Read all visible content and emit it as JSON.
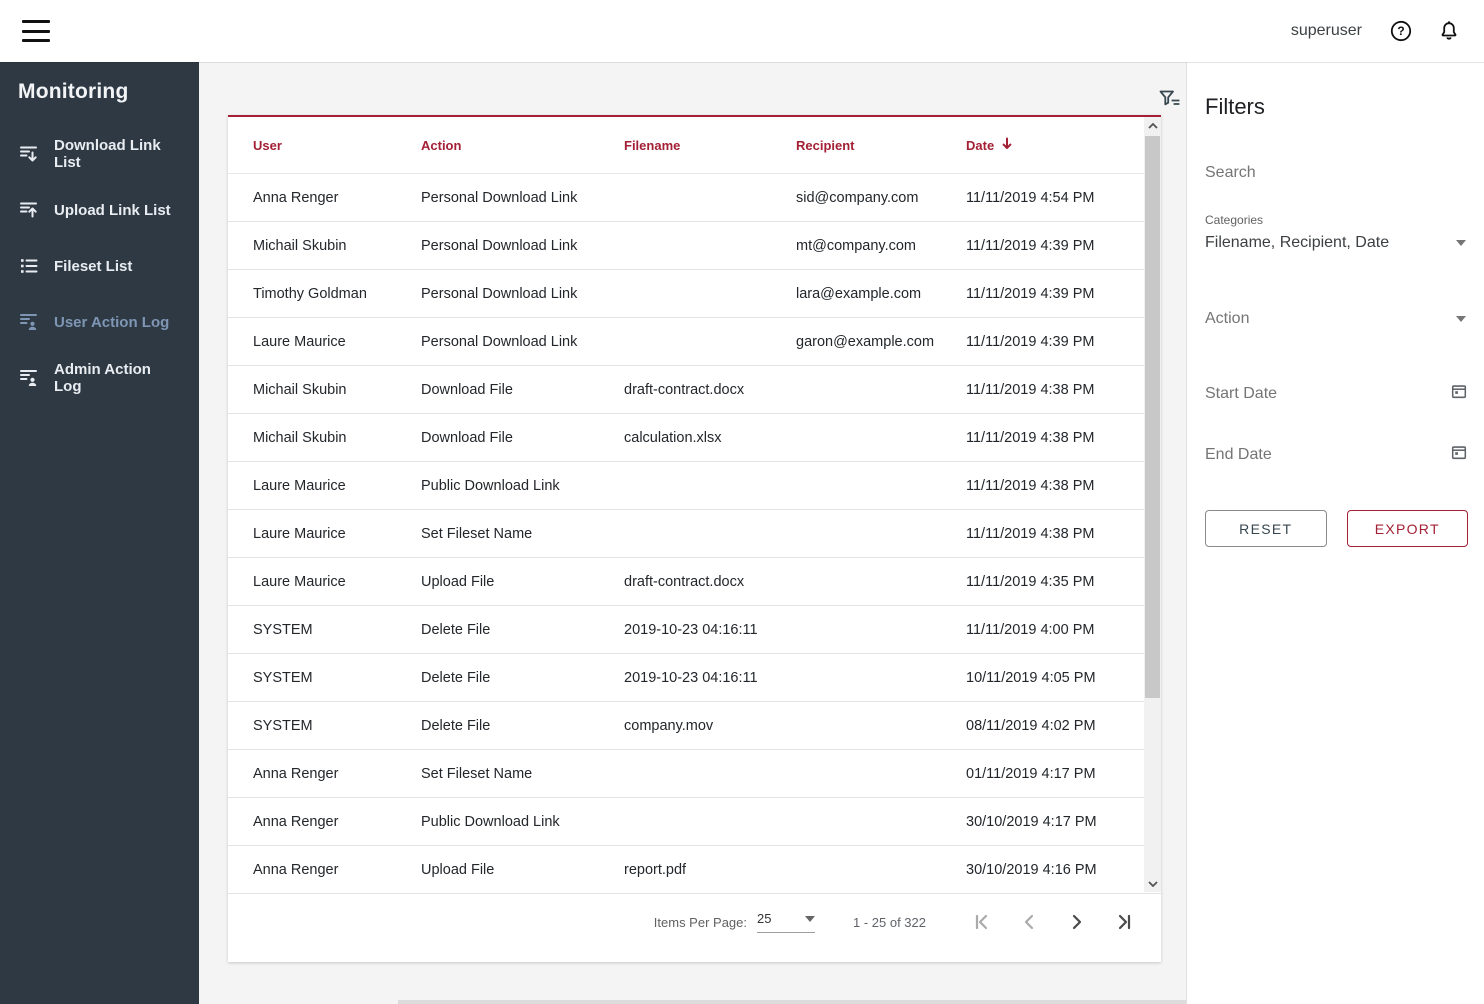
{
  "topbar": {
    "username": "superuser"
  },
  "sidebar": {
    "title": "Monitoring",
    "items": [
      {
        "label": "Download Link List",
        "icon": "download-list-icon",
        "active": false
      },
      {
        "label": "Upload Link List",
        "icon": "upload-list-icon",
        "active": false
      },
      {
        "label": "Fileset List",
        "icon": "fileset-list-icon",
        "active": false
      },
      {
        "label": "User Action Log",
        "icon": "user-log-icon",
        "active": true
      },
      {
        "label": "Admin Action Log",
        "icon": "admin-log-icon",
        "active": false
      }
    ]
  },
  "table": {
    "columns": [
      "User",
      "Action",
      "Filename",
      "Recipient",
      "Date"
    ],
    "sort_column": "Date",
    "sort_direction": "desc",
    "rows": [
      {
        "user": "Anna Renger",
        "action": "Personal Download Link",
        "filename": "",
        "recipient": "sid@company.com",
        "date": "11/11/2019 4:54 PM"
      },
      {
        "user": "Michail Skubin",
        "action": "Personal Download Link",
        "filename": "",
        "recipient": "mt@company.com",
        "date": "11/11/2019 4:39 PM"
      },
      {
        "user": "Timothy Goldman",
        "action": "Personal Download Link",
        "filename": "",
        "recipient": "lara@example.com",
        "date": "11/11/2019 4:39 PM"
      },
      {
        "user": "Laure Maurice",
        "action": "Personal Download Link",
        "filename": "",
        "recipient": "garon@example.com",
        "date": "11/11/2019 4:39 PM"
      },
      {
        "user": "Michail Skubin",
        "action": "Download File",
        "filename": "draft-contract.docx",
        "recipient": "",
        "date": "11/11/2019 4:38 PM"
      },
      {
        "user": "Michail Skubin",
        "action": "Download File",
        "filename": "calculation.xlsx",
        "recipient": "",
        "date": "11/11/2019 4:38 PM"
      },
      {
        "user": "Laure Maurice",
        "action": "Public Download Link",
        "filename": "",
        "recipient": "",
        "date": "11/11/2019 4:38 PM"
      },
      {
        "user": "Laure Maurice",
        "action": "Set Fileset Name",
        "filename": "",
        "recipient": "",
        "date": "11/11/2019 4:38 PM"
      },
      {
        "user": "Laure Maurice",
        "action": "Upload File",
        "filename": "draft-contract.docx",
        "recipient": "",
        "date": "11/11/2019 4:35 PM"
      },
      {
        "user": "SYSTEM",
        "action": "Delete File",
        "filename": "2019-10-23 04:16:11",
        "recipient": "",
        "date": "11/11/2019 4:00 PM"
      },
      {
        "user": "SYSTEM",
        "action": "Delete File",
        "filename": "2019-10-23 04:16:11",
        "recipient": "",
        "date": "10/11/2019 4:05 PM"
      },
      {
        "user": "SYSTEM",
        "action": "Delete File",
        "filename": "company.mov",
        "recipient": "",
        "date": "08/11/2019 4:02 PM"
      },
      {
        "user": "Anna Renger",
        "action": "Set Fileset Name",
        "filename": "",
        "recipient": "",
        "date": "01/11/2019 4:17 PM"
      },
      {
        "user": "Anna Renger",
        "action": "Public Download Link",
        "filename": "",
        "recipient": "",
        "date": "30/10/2019 4:17 PM"
      },
      {
        "user": "Anna Renger",
        "action": "Upload File",
        "filename": "report.pdf",
        "recipient": "",
        "date": "30/10/2019 4:16 PM"
      }
    ]
  },
  "pagination": {
    "items_per_page_label": "Items Per Page:",
    "items_per_page_value": "25",
    "range_text": "1 - 25 of 322"
  },
  "filters": {
    "title": "Filters",
    "search_placeholder": "Search",
    "categories_label": "Categories",
    "categories_value": "Filename, Recipient, Date",
    "action_placeholder": "Action",
    "start_date_placeholder": "Start Date",
    "end_date_placeholder": "End Date",
    "reset_label": "RESET",
    "export_label": "EXPORT"
  },
  "colors": {
    "accent_red": "#a32035",
    "sidebar_bg": "#2e3944",
    "active_item_blue": "#7e96b4"
  }
}
